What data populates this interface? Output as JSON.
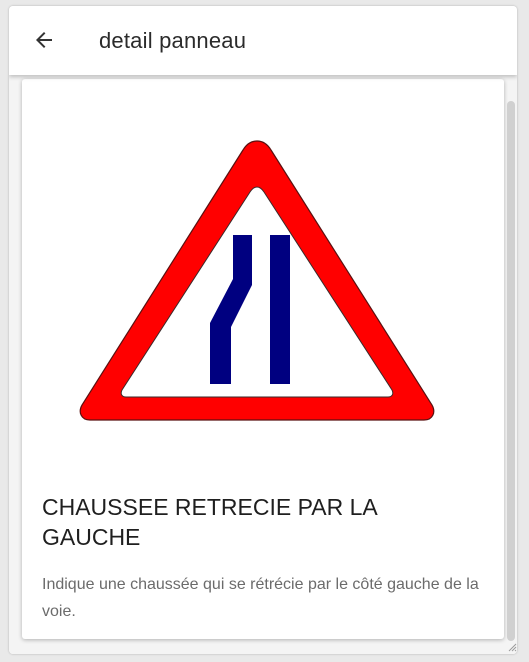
{
  "appbar": {
    "title": "detail panneau",
    "back_icon": "arrow-left-icon"
  },
  "card": {
    "image_icon": "road-narrows-left-sign",
    "title": "CHAUSSEE RETRECIE PAR LA GAUCHE",
    "description": "Indique une chaussée qui se rétrécie par le côté gauche de la voie."
  },
  "colors": {
    "sign_red": "#ff0000",
    "sign_blue": "#000080",
    "appbar_bg": "#ffffff",
    "text_primary": "#1f1f1f",
    "text_secondary": "#6b6b6b"
  }
}
